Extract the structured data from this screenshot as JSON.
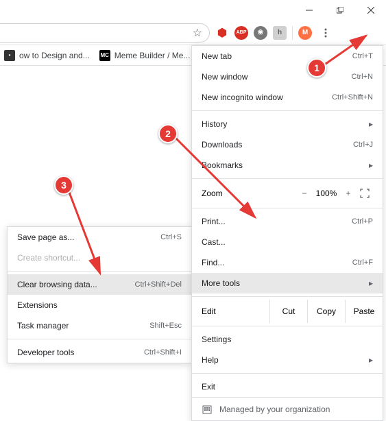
{
  "window_controls": {
    "min": "min",
    "max": "max",
    "close": "close"
  },
  "toolbar": {
    "star_icon": "star",
    "ext": [
      {
        "name": "ublock",
        "bg": "#fff",
        "fg": "#d93025",
        "txt": "⬢"
      },
      {
        "name": "abp",
        "bg": "#d93025",
        "fg": "#fff",
        "txt": "ABP"
      },
      {
        "name": "ext3",
        "bg": "#666",
        "fg": "#fff",
        "txt": "✿"
      },
      {
        "name": "ext4",
        "bg": "#ccc",
        "fg": "#666",
        "txt": "h"
      }
    ],
    "avatar": {
      "letter": "M",
      "bg": "#ff7043"
    }
  },
  "bookmarks": [
    {
      "icon_bg": "#333",
      "icon_txt": "•",
      "label": "ow to Design and..."
    },
    {
      "icon_bg": "#000",
      "icon_txt": "MC",
      "label": "Meme Builder / Me..."
    }
  ],
  "menu": {
    "new_tab": {
      "label": "New tab",
      "shortcut": "Ctrl+T"
    },
    "new_window": {
      "label": "New window",
      "shortcut": "Ctrl+N"
    },
    "new_incog": {
      "label": "New incognito window",
      "shortcut": "Ctrl+Shift+N"
    },
    "history": {
      "label": "History"
    },
    "downloads": {
      "label": "Downloads",
      "shortcut": "Ctrl+J"
    },
    "bookmarks": {
      "label": "Bookmarks"
    },
    "zoom": {
      "label": "Zoom",
      "minus": "−",
      "pct": "100%",
      "plus": "+"
    },
    "print": {
      "label": "Print...",
      "shortcut": "Ctrl+P"
    },
    "cast": {
      "label": "Cast..."
    },
    "find": {
      "label": "Find...",
      "shortcut": "Ctrl+F"
    },
    "more_tools": {
      "label": "More tools"
    },
    "edit": {
      "label": "Edit",
      "cut": "Cut",
      "copy": "Copy",
      "paste": "Paste"
    },
    "settings": {
      "label": "Settings"
    },
    "help": {
      "label": "Help"
    },
    "exit": {
      "label": "Exit"
    },
    "managed": {
      "label": "Managed by your organization"
    }
  },
  "submenu": {
    "save_page": {
      "label": "Save page as...",
      "shortcut": "Ctrl+S"
    },
    "create_shortcut": {
      "label": "Create shortcut..."
    },
    "clear_data": {
      "label": "Clear browsing data...",
      "shortcut": "Ctrl+Shift+Del"
    },
    "extensions": {
      "label": "Extensions"
    },
    "task_mgr": {
      "label": "Task manager",
      "shortcut": "Shift+Esc"
    },
    "dev_tools": {
      "label": "Developer tools",
      "shortcut": "Ctrl+Shift+I"
    }
  },
  "badges": {
    "one": "1",
    "two": "2",
    "three": "3"
  }
}
